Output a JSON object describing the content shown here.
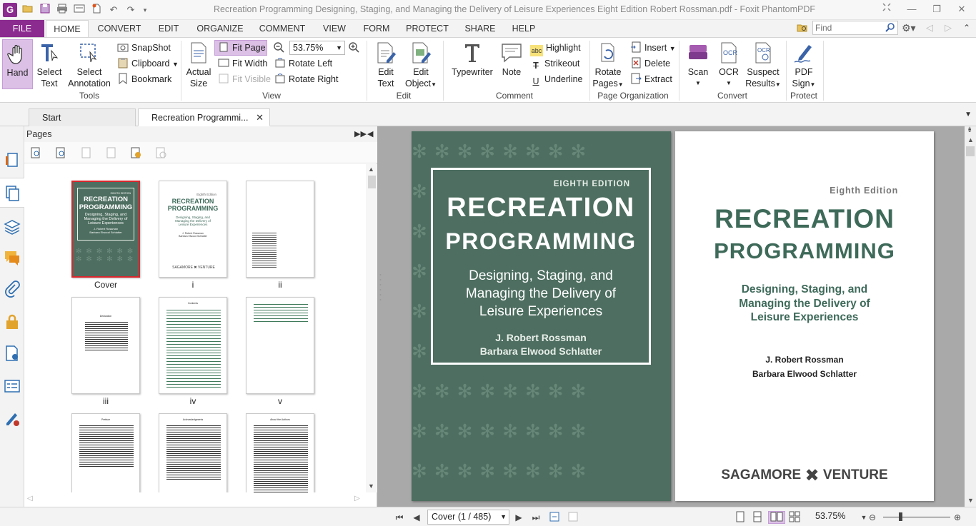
{
  "window": {
    "title": "Recreation Programming Designing, Staging, and Managing the Delivery of Leisure Experiences Eight Edition Robert Rossman.pdf - Foxit PhantomPDF",
    "app_icon": "G"
  },
  "menu": {
    "file": "FILE",
    "tabs": [
      "HOME",
      "CONVERT",
      "EDIT",
      "ORGANIZE",
      "COMMENT",
      "VIEW",
      "FORM",
      "PROTECT",
      "SHARE",
      "HELP"
    ],
    "active_tab": "HOME",
    "find_placeholder": "Find"
  },
  "ribbon": {
    "tools": {
      "hand": "Hand",
      "select_text_1": "Select",
      "select_text_2": "Text",
      "select_ann_1": "Select",
      "select_ann_2": "Annotation",
      "snapshot": "SnapShot",
      "clipboard": "Clipboard",
      "bookmark": "Bookmark",
      "label": "Tools"
    },
    "view": {
      "actual_1": "Actual",
      "actual_2": "Size",
      "fit_page": "Fit Page",
      "fit_width": "Fit Width",
      "fit_visible": "Fit Visible",
      "zoom_value": "53.75%",
      "rotate_left": "Rotate Left",
      "rotate_right": "Rotate Right",
      "label": "View"
    },
    "edit": {
      "edit_text_1": "Edit",
      "edit_text_2": "Text",
      "edit_object_1": "Edit",
      "edit_object_2": "Object",
      "label": "Edit"
    },
    "comment": {
      "typewriter": "Typewriter",
      "note": "Note",
      "highlight": "Highlight",
      "strikeout": "Strikeout",
      "underline": "Underline",
      "label": "Comment"
    },
    "organization": {
      "rotate_pages_1": "Rotate",
      "rotate_pages_2": "Pages",
      "insert": "Insert",
      "delete": "Delete",
      "extract": "Extract",
      "label": "Page Organization"
    },
    "convert": {
      "scan": "Scan",
      "ocr": "OCR",
      "suspect_1": "Suspect",
      "suspect_2": "Results",
      "label": "Convert"
    },
    "protect": {
      "pdf_sign_1": "PDF",
      "pdf_sign_2": "Sign",
      "label": "Protect"
    }
  },
  "doc_tabs": {
    "start": "Start",
    "current": "Recreation Programmi..."
  },
  "pages_panel": {
    "title": "Pages",
    "thumbnails": [
      {
        "label": "Cover"
      },
      {
        "label": "i"
      },
      {
        "label": "ii"
      },
      {
        "label": "iii"
      },
      {
        "label": "iv"
      },
      {
        "label": "v"
      },
      {
        "label": ""
      },
      {
        "label": ""
      },
      {
        "label": ""
      }
    ]
  },
  "book": {
    "edition_cover": "EIGHTH EDITION",
    "edition_title": "Eighth Edition",
    "title_1": "RECREATION",
    "title_2": "PROGRAMMING",
    "subtitle_1": "Designing, Staging, and",
    "subtitle_2": "Managing the Delivery of",
    "subtitle_3": "Leisure Experiences",
    "author_1": "J. Robert Rossman",
    "author_2": "Barbara Elwood Schlatter",
    "publisher_left": "SAGAMORE",
    "publisher_right": "VENTURE",
    "thumb_small_edition": "EIGHTH EDITION",
    "thumb_title_edition": "Eighth Edition",
    "contents_heading": "Contents",
    "preface_heading": "Preface",
    "ack_heading": "Acknowledgments",
    "about_heading": "About the Authors",
    "dedication_heading": "Dedication"
  },
  "status": {
    "page_select": "Cover (1 / 485)",
    "zoom": "53.75%",
    "zoom_slider_fraction": 0.25
  },
  "colors": {
    "accent": "#8b2b8f",
    "cover_green": "#4d6e60",
    "title_green": "#3e6a5a"
  }
}
